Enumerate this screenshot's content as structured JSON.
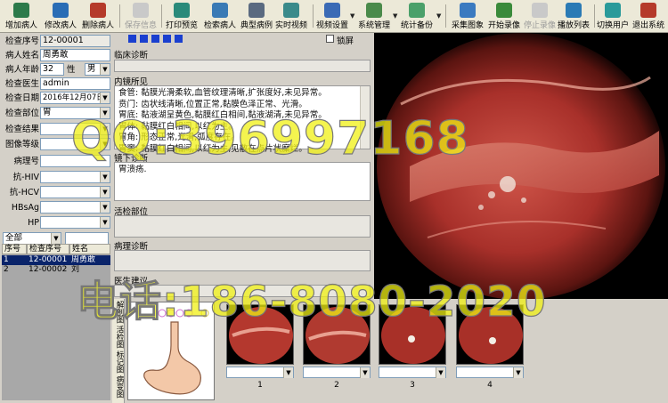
{
  "toolbar": {
    "buttons": [
      {
        "label": "增加病人",
        "icon": "add-patient-icon",
        "color": "#2c7a4a"
      },
      {
        "label": "修改病人",
        "icon": "edit-patient-icon",
        "color": "#2a6db5"
      },
      {
        "label": "删除病人",
        "icon": "delete-patient-icon",
        "color": "#b53a2a"
      },
      {
        "label": "保存信息",
        "icon": "save-icon",
        "color": "#9a9a9a"
      },
      {
        "label": "打印预览",
        "icon": "print-preview-icon",
        "color": "#2a8a7a"
      },
      {
        "label": "检索病人",
        "icon": "search-patient-icon",
        "color": "#3a7ab5"
      },
      {
        "label": "典型病例",
        "icon": "typical-case-icon",
        "color": "#5a6a80"
      },
      {
        "label": "实时视频",
        "icon": "live-video-icon",
        "color": "#3a8a8a"
      },
      {
        "label": "视频设置",
        "icon": "video-settings-icon",
        "color": "#3a6ab5"
      },
      {
        "label": "系统管理",
        "icon": "system-admin-icon",
        "color": "#4a8a4a"
      },
      {
        "label": "统计备份",
        "icon": "stats-backup-icon",
        "color": "#4aa06a"
      },
      {
        "label": "采集图象",
        "icon": "capture-image-icon",
        "color": "#3a7ac0"
      },
      {
        "label": "开始录像",
        "icon": "start-record-icon",
        "color": "#3a8a3a"
      },
      {
        "label": "停止录像",
        "icon": "stop-record-icon",
        "color": "#9a9a9a"
      },
      {
        "label": "播放列表",
        "icon": "playlist-icon",
        "color": "#2a7ab5"
      },
      {
        "label": "切换用户",
        "icon": "switch-user-icon",
        "color": "#2a9a9a"
      },
      {
        "label": "退出系统",
        "icon": "exit-icon",
        "color": "#b53a2a"
      }
    ]
  },
  "form": {
    "exam_no_label": "检查序号",
    "exam_no": "12-00001",
    "name_label": "病人姓名",
    "name": "周勇敢",
    "age_label": "病人年龄",
    "age": "32",
    "sex_label": "性别",
    "sex": "男",
    "doctor_label": "检查医生",
    "doctor": "admin",
    "date_label": "检查日期",
    "date": "2016年12月07日",
    "site_label": "检查部位",
    "site": "胃",
    "result_label": "检查结果",
    "grade_label": "图像等级",
    "pathology_no_label": "病理号",
    "hiv_label": "抗-HIV",
    "hcv_label": "抗-HCV",
    "hbsag_label": "HBsAg",
    "hp_label": "HP",
    "filter": "全部"
  },
  "grid": {
    "headers": [
      "序号",
      "检查序号",
      "姓名"
    ],
    "rows": [
      {
        "idx": "1",
        "exam": "12-00001",
        "name": "周勇敢"
      },
      {
        "idx": "2",
        "exam": "12-00002",
        "name": "刘"
      }
    ]
  },
  "mid": {
    "lock_label": "锁屏",
    "clinical_label": "临床诊断",
    "findings_label": "内镜所见",
    "findings_text": "食管: 黏膜光滑柔软,血管纹理清晰,扩张度好,未见异常。\n贲门: 齿状线清晰,位置正常,黏膜色泽正常、光滑。\n胃底: 黏液湖呈黄色,黏膜红白相间,黏液湖清,未见异常。\n胃体: 黏膜红白相间,以红为主。\n胃角: 形态正常,光滑,弧度存在。\n胃窦: 黏膜红白相间,以红为主,见散在点片状糜烂。",
    "conclusion_label": "镜下诊断",
    "conclusion_text": "胃溃疡.",
    "biopsy_label": "活检部位",
    "pathology_label": "病理诊断",
    "advice_label": "医生建议"
  },
  "side_tabs": [
    "解剖图",
    "活检图",
    "标记图",
    "病变图"
  ],
  "thumbs": [
    "1",
    "2",
    "3",
    "4"
  ],
  "watermark": {
    "line1": "QQ:396997168",
    "line2": "电话:186-8080-2020"
  },
  "colors": {
    "selected_row": "#0a246a",
    "nav_blue": "#1a3fcf",
    "watermark": "#f0f014"
  }
}
